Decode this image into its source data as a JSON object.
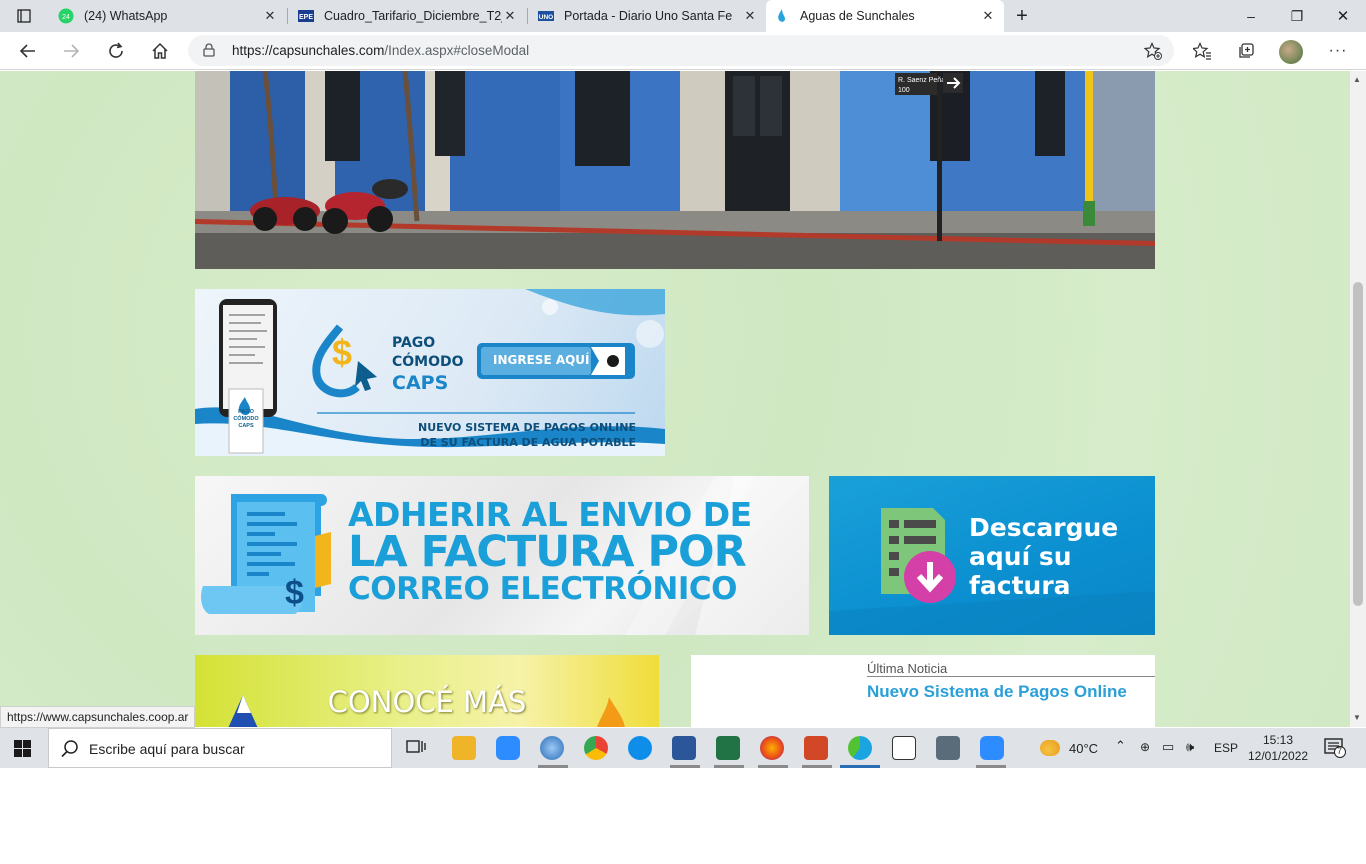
{
  "browser": {
    "tabs": [
      {
        "label": "(24) WhatsApp",
        "badge": "24",
        "icon": "whatsapp-icon"
      },
      {
        "label": "Cuadro_Tarifario_Diciembre_T2_2",
        "icon": "epe-icon"
      },
      {
        "label": "Portada - Diario Uno Santa Fe",
        "icon": "uno-icon"
      },
      {
        "label": "Aguas de Sunchales",
        "icon": "water-drop-icon",
        "active": true
      }
    ],
    "new_tab_symbol": "+",
    "url_host": "https://capsunchales.com",
    "url_rest": "/Index.aspx#closeModal",
    "window_controls": {
      "minimize": "–",
      "restore": "❐",
      "close": "✕"
    }
  },
  "page": {
    "pago": {
      "l1": "PAGO",
      "l2": "CÓMODO",
      "l3": "CAPS",
      "button": "INGRESE AQUÍ",
      "sub1": "NUEVO SISTEMA DE PAGOS ONLINE",
      "sub2": "DE SU FACTURA DE AGUA POTABLE",
      "phone_caption": [
        "PAGO",
        "CÓMODO",
        "CAPS"
      ]
    },
    "adherir": {
      "l1": "ADHERIR AL ENVIO DE",
      "l2": "LA FACTURA POR",
      "l3": "CORREO ELECTRÓNICO"
    },
    "descargue": {
      "l1": "Descargue",
      "l2": "aquí su",
      "l3": "factura"
    },
    "conoce": {
      "title": "CONOCÉ MÁS"
    },
    "noticia": {
      "label": "Última Noticia",
      "headline": "Nuevo Sistema de Pagos Online"
    },
    "street_sign": {
      "name": "R. Saenz Peña",
      "number": "100"
    }
  },
  "status_url": "https://www.capsunchales.coop.ar",
  "taskbar": {
    "search_placeholder": "Escribe aquí para buscar",
    "weather": "40°C",
    "language": "ESP",
    "time": "15:13",
    "date": "12/01/2022",
    "notification_count": "7"
  },
  "colors": {
    "page_bg": "#d3eac6",
    "caps_blue": "#1aa6dc",
    "caps_navy": "#0d5e8f",
    "news_blue": "#2a9fd8"
  }
}
